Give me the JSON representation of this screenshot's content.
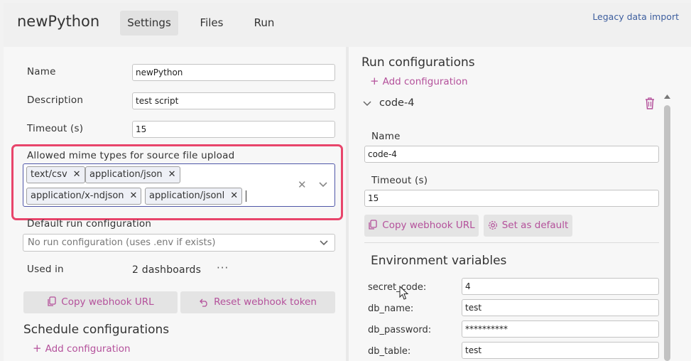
{
  "app": {
    "title": "newPython"
  },
  "tabs": [
    {
      "label": "Settings",
      "active": true
    },
    {
      "label": "Files"
    },
    {
      "label": "Run"
    }
  ],
  "header": {
    "legacy_link": "Legacy data import"
  },
  "form": {
    "name_label": "Name",
    "name_value": "newPython",
    "description_label": "Description",
    "description_value": "test script",
    "timeout_label": "Timeout (s)",
    "timeout_value": "15",
    "mime_label": "Allowed mime types for source file upload",
    "mime_types": [
      "text/csv",
      "application/json",
      "application/x-ndjson",
      "application/jsonl"
    ],
    "default_run_label": "Default run configuration",
    "default_run_value": "No run configuration (uses .env if exists)",
    "used_in_label": "Used in",
    "used_in_value": "2 dashboards",
    "copy_webhook": "Copy webhook URL",
    "reset_webhook": "Reset webhook token",
    "schedule_title": "Schedule configurations",
    "add_schedule": "Add configuration"
  },
  "run_configs": {
    "title": "Run configurations",
    "add_config": "Add configuration",
    "item": {
      "name": "code-4",
      "name_label": "Name",
      "name_value": "code-4",
      "timeout_label": "Timeout (s)",
      "timeout_value": "15",
      "copy_webhook": "Copy webhook URL",
      "set_default": "Set as default",
      "env_title": "Environment variables",
      "env": [
        {
          "key": "secret_code:",
          "value": "4"
        },
        {
          "key": "db_name:",
          "value": "test"
        },
        {
          "key": "db_password:",
          "value": "**********"
        },
        {
          "key": "db_table:",
          "value": "test"
        }
      ]
    }
  },
  "colors": {
    "accent": "#b4519b",
    "highlight": "#e8456b",
    "focus": "#4f57a8"
  }
}
